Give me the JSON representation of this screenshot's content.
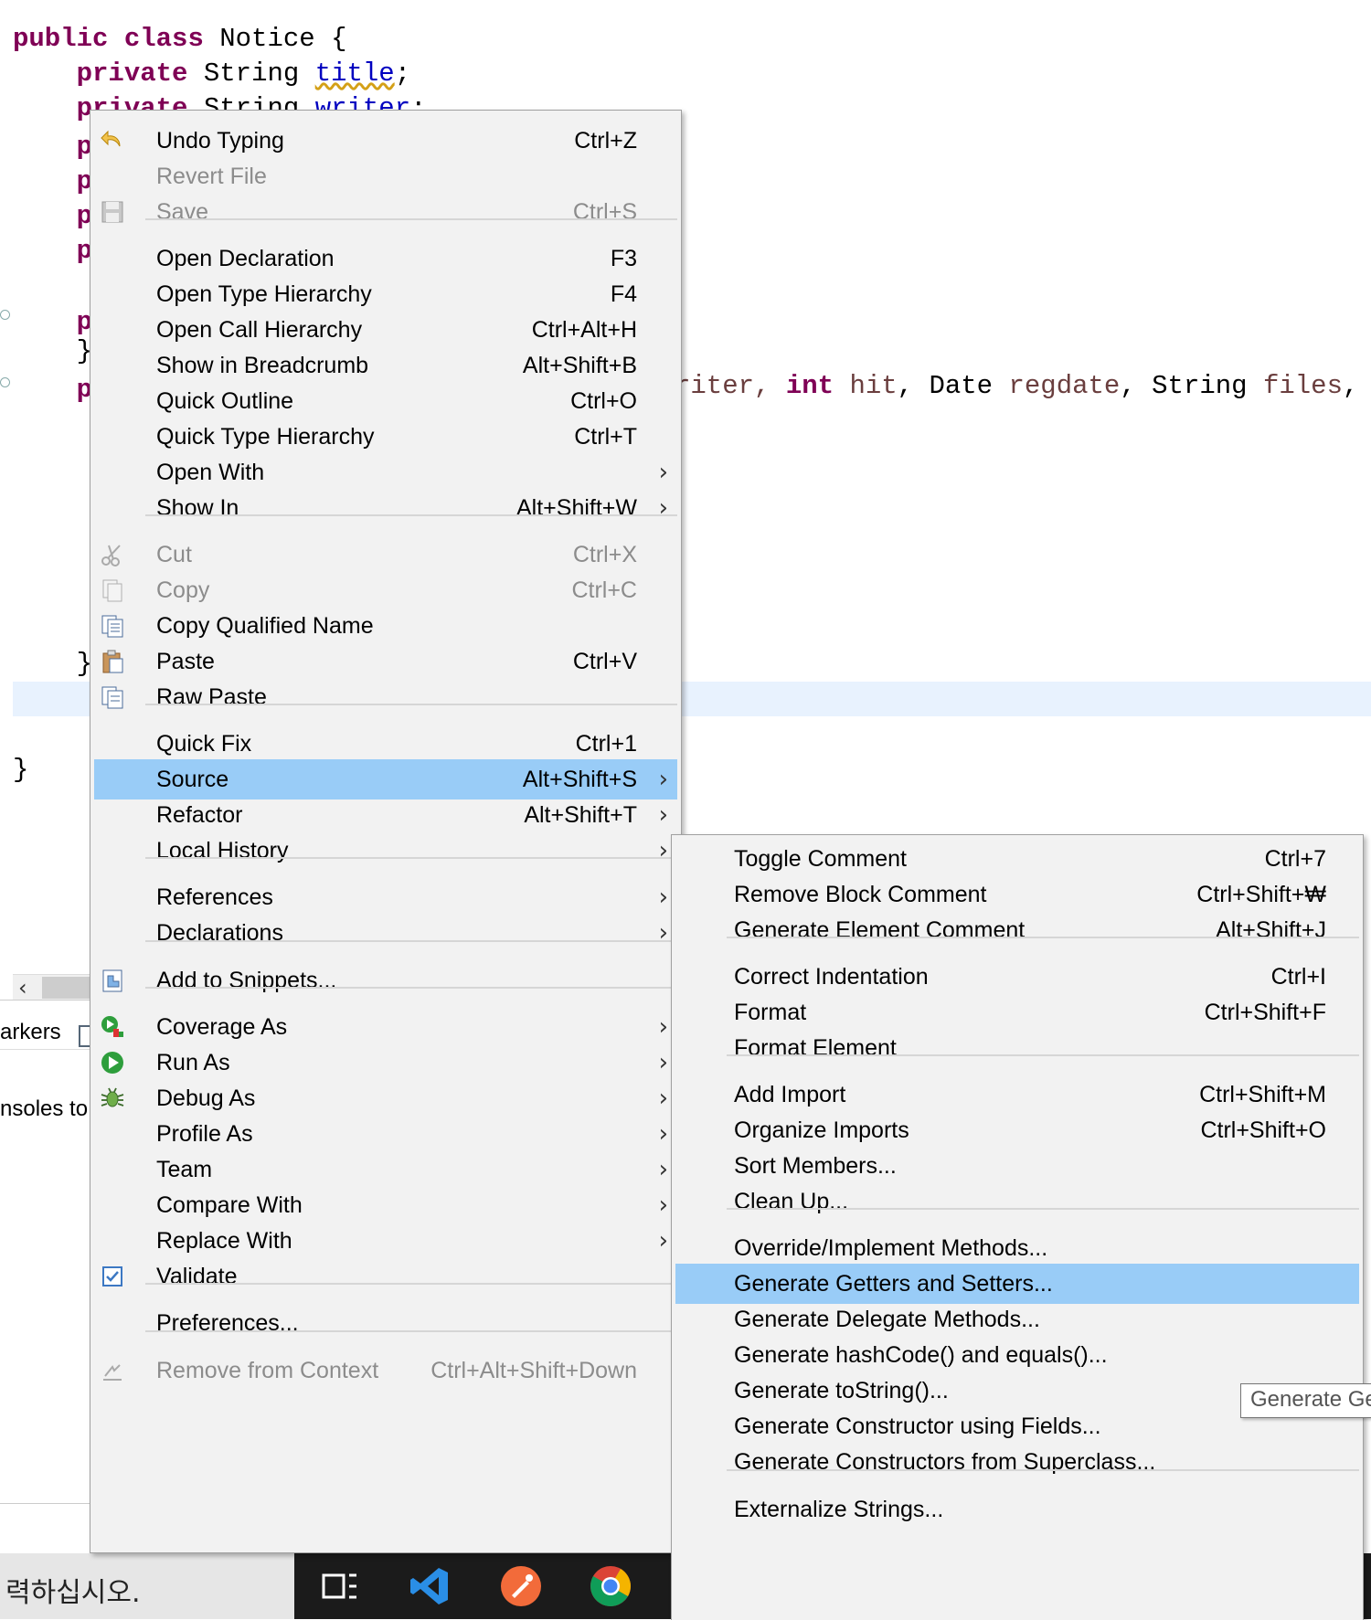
{
  "editor": {
    "line1": {
      "kw1": "public",
      "kw2": "class",
      "name": "Notice {"
    },
    "line2": {
      "kw": "private",
      "type": "String",
      "field": "title",
      "end": ";"
    },
    "line3": {
      "kw": "private",
      "type": "String",
      "field": "writer",
      "end": ";"
    },
    "constructor_tail": {
      "pre": "riter, ",
      "kw": "int",
      "t1": " ",
      "p1": "hit",
      "c1": ", Date ",
      "p2": "regdate",
      "c2": ", String ",
      "p3": "files",
      "end": ","
    },
    "closing_brace": "}",
    "partial_p": "p",
    "partial_brace": "}"
  },
  "bottom_panel": {
    "tab_label": "arkers",
    "text": "nsoles to"
  },
  "taskbar": {
    "input_text": "력하십시오."
  },
  "context_menu": {
    "items": [
      {
        "label": "Undo Typing",
        "shortcut": "Ctrl+Z",
        "icon": "undo-icon"
      },
      {
        "label": "Revert File",
        "shortcut": "",
        "disabled": true
      },
      {
        "label": "Save",
        "shortcut": "Ctrl+S",
        "disabled": true,
        "icon": "save-icon"
      },
      {
        "label": "Open Declaration",
        "shortcut": "F3"
      },
      {
        "label": "Open Type Hierarchy",
        "shortcut": "F4"
      },
      {
        "label": "Open Call Hierarchy",
        "shortcut": "Ctrl+Alt+H"
      },
      {
        "label": "Show in Breadcrumb",
        "shortcut": "Alt+Shift+B"
      },
      {
        "label": "Quick Outline",
        "shortcut": "Ctrl+O"
      },
      {
        "label": "Quick Type Hierarchy",
        "shortcut": "Ctrl+T"
      },
      {
        "label": "Open With",
        "shortcut": "",
        "submenu": true
      },
      {
        "label": "Show In",
        "shortcut": "Alt+Shift+W",
        "submenu": true
      },
      {
        "label": "Cut",
        "shortcut": "Ctrl+X",
        "disabled": true,
        "icon": "scissors-icon"
      },
      {
        "label": "Copy",
        "shortcut": "Ctrl+C",
        "disabled": true,
        "icon": "copy-icon"
      },
      {
        "label": "Copy Qualified Name",
        "shortcut": "",
        "icon": "copy-qualified-icon"
      },
      {
        "label": "Paste",
        "shortcut": "Ctrl+V",
        "icon": "clipboard-icon"
      },
      {
        "label": "Raw Paste",
        "shortcut": "",
        "icon": "raw-paste-icon"
      },
      {
        "label": "Quick Fix",
        "shortcut": "Ctrl+1"
      },
      {
        "label": "Source",
        "shortcut": "Alt+Shift+S",
        "submenu": true,
        "highlighted": true
      },
      {
        "label": "Refactor",
        "shortcut": "Alt+Shift+T",
        "submenu": true
      },
      {
        "label": "Local History",
        "shortcut": "",
        "submenu": true
      },
      {
        "label": "References",
        "shortcut": "",
        "submenu": true
      },
      {
        "label": "Declarations",
        "shortcut": "",
        "submenu": true
      },
      {
        "label": "Add to Snippets...",
        "shortcut": "",
        "icon": "snippet-icon"
      },
      {
        "label": "Coverage As",
        "shortcut": "",
        "submenu": true,
        "icon": "coverage-icon"
      },
      {
        "label": "Run As",
        "shortcut": "",
        "submenu": true,
        "icon": "run-icon"
      },
      {
        "label": "Debug As",
        "shortcut": "",
        "submenu": true,
        "icon": "bug-icon"
      },
      {
        "label": "Profile As",
        "shortcut": "",
        "submenu": true
      },
      {
        "label": "Team",
        "shortcut": "",
        "submenu": true
      },
      {
        "label": "Compare With",
        "shortcut": "",
        "submenu": true
      },
      {
        "label": "Replace With",
        "shortcut": "",
        "submenu": true
      },
      {
        "label": "Validate",
        "shortcut": "",
        "icon": "checkbox-icon"
      },
      {
        "label": "Preferences...",
        "shortcut": ""
      },
      {
        "label": "Remove from Context",
        "shortcut": "Ctrl+Alt+Shift+Down",
        "disabled": true,
        "icon": "context-icon"
      }
    ]
  },
  "source_submenu": {
    "items": [
      {
        "label": "Toggle Comment",
        "shortcut": "Ctrl+7"
      },
      {
        "label": "Remove Block Comment",
        "shortcut": "Ctrl+Shift+₩"
      },
      {
        "label": "Generate Element Comment",
        "shortcut": "Alt+Shift+J"
      },
      {
        "label": "Correct Indentation",
        "shortcut": "Ctrl+I"
      },
      {
        "label": "Format",
        "shortcut": "Ctrl+Shift+F"
      },
      {
        "label": "Format Element",
        "shortcut": ""
      },
      {
        "label": "Add Import",
        "shortcut": "Ctrl+Shift+M"
      },
      {
        "label": "Organize Imports",
        "shortcut": "Ctrl+Shift+O"
      },
      {
        "label": "Sort Members...",
        "shortcut": ""
      },
      {
        "label": "Clean Up...",
        "shortcut": ""
      },
      {
        "label": "Override/Implement Methods...",
        "shortcut": ""
      },
      {
        "label": "Generate Getters and Setters...",
        "shortcut": "",
        "highlighted": true
      },
      {
        "label": "Generate Delegate Methods...",
        "shortcut": ""
      },
      {
        "label": "Generate hashCode() and equals()...",
        "shortcut": ""
      },
      {
        "label": "Generate toString()...",
        "shortcut": ""
      },
      {
        "label": "Generate Constructor using Fields...",
        "shortcut": ""
      },
      {
        "label": "Generate Constructors from Superclass...",
        "shortcut": ""
      },
      {
        "label": "Externalize Strings...",
        "shortcut": ""
      }
    ]
  },
  "tooltip": {
    "text": "Generate Ge"
  },
  "colors": {
    "highlight": "#99ccf7",
    "menu_bg": "#f2f2f2",
    "keyword": "#7f0055",
    "field": "#0000c0"
  }
}
